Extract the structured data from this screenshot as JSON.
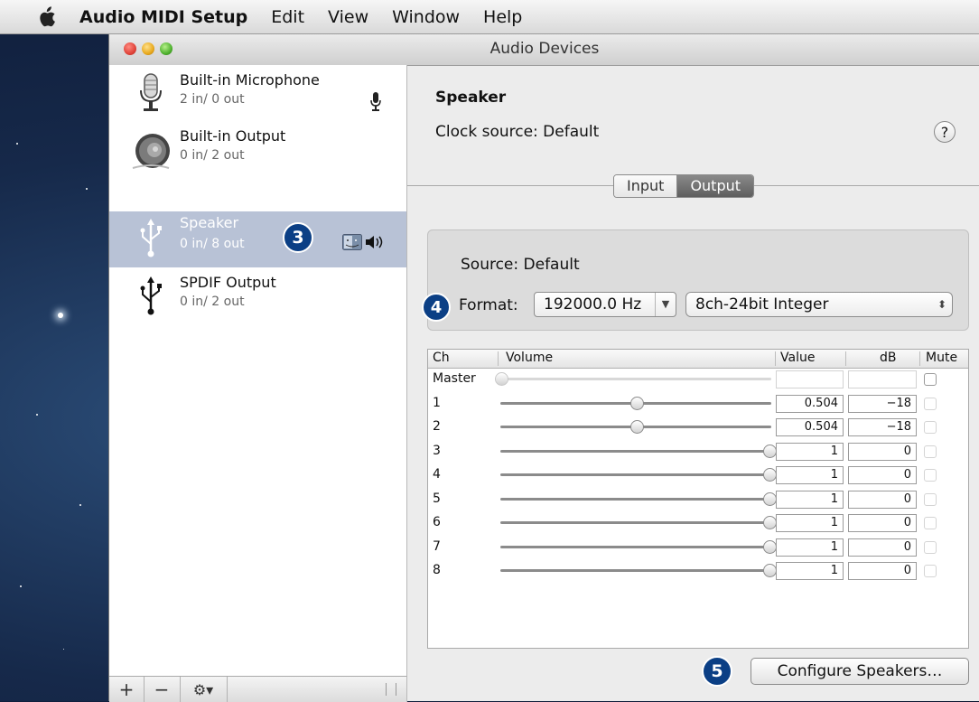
{
  "menubar": {
    "app_name": "Audio MIDI Setup",
    "items": [
      "Edit",
      "View",
      "Window",
      "Help"
    ]
  },
  "window": {
    "title": "Audio Devices"
  },
  "devices": [
    {
      "name": "Built-in Microphone",
      "io": "2 in/ 0 out",
      "icon": "microphone-icon",
      "status_icon": "microphone-small-icon",
      "selected": false
    },
    {
      "name": "Built-in Output",
      "io": "0 in/ 2 out",
      "icon": "speaker-icon",
      "selected": false
    },
    {
      "name": "Speaker",
      "io": "0 in/ 8 out",
      "icon": "usb-icon",
      "status_icons": [
        "finder-icon",
        "speaker-volume-icon"
      ],
      "selected": true
    },
    {
      "name": "SPDIF Output",
      "io": "0 in/ 2 out",
      "icon": "usb-icon",
      "selected": false
    }
  ],
  "sidebar_toolbar": {
    "add": "+",
    "remove": "−",
    "gear": "⚙▾"
  },
  "badges": {
    "b3": "3",
    "b4": "4",
    "b5": "5"
  },
  "detail": {
    "title": "Speaker",
    "clock_source": "Clock source: Default",
    "help": "?",
    "tabs": {
      "input": "Input",
      "output": "Output",
      "active": "output"
    },
    "source": "Source: Default",
    "format_label": "Format:",
    "sample_rate": "192000.0 Hz",
    "format": "8ch-24bit Integer"
  },
  "table": {
    "headers": {
      "ch": "Ch",
      "volume": "Volume",
      "value": "Value",
      "db": "dB",
      "mute": "Mute"
    },
    "rows": [
      {
        "ch": "Master",
        "level": 0,
        "value": "",
        "db": "",
        "muted": false,
        "enabled": false
      },
      {
        "ch": "1",
        "level": 0.504,
        "value": "0.504",
        "db": "−18",
        "muted": false,
        "enabled": true
      },
      {
        "ch": "2",
        "level": 0.504,
        "value": "0.504",
        "db": "−18",
        "muted": false,
        "enabled": true
      },
      {
        "ch": "3",
        "level": 1,
        "value": "1",
        "db": "0",
        "muted": false,
        "enabled": true
      },
      {
        "ch": "4",
        "level": 1,
        "value": "1",
        "db": "0",
        "muted": false,
        "enabled": true
      },
      {
        "ch": "5",
        "level": 1,
        "value": "1",
        "db": "0",
        "muted": false,
        "enabled": true
      },
      {
        "ch": "6",
        "level": 1,
        "value": "1",
        "db": "0",
        "muted": false,
        "enabled": true
      },
      {
        "ch": "7",
        "level": 1,
        "value": "1",
        "db": "0",
        "muted": false,
        "enabled": true
      },
      {
        "ch": "8",
        "level": 1,
        "value": "1",
        "db": "0",
        "muted": false,
        "enabled": true
      }
    ]
  },
  "configure_button": "Configure Speakers…"
}
